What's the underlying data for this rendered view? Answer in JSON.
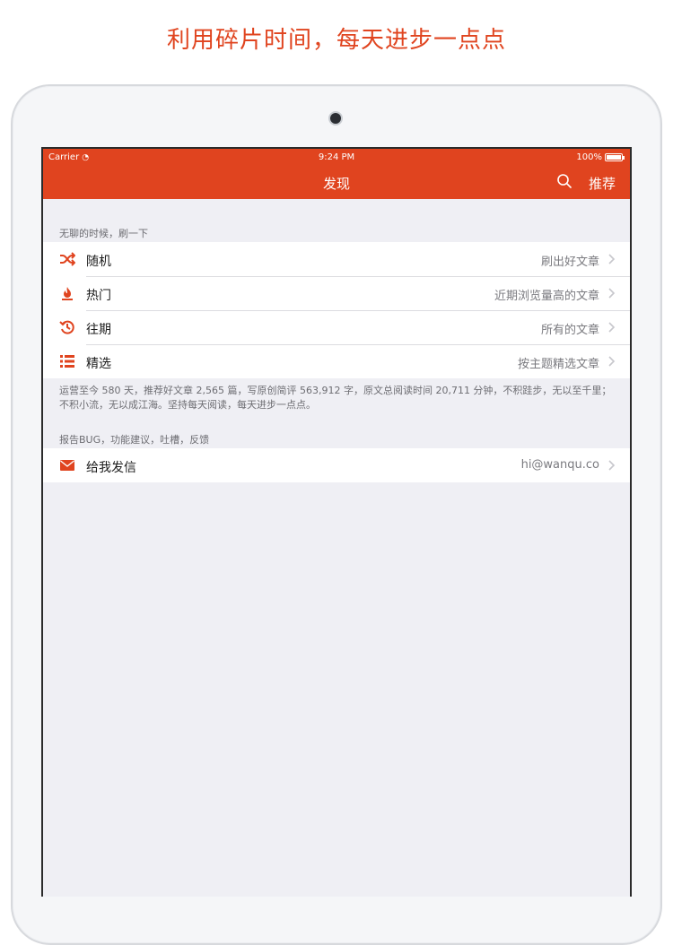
{
  "promo": {
    "title": "利用碎片时间，每天进步一点点"
  },
  "status_bar": {
    "carrier": "Carrier",
    "time": "9:24 PM",
    "battery": "100%"
  },
  "navbar": {
    "title": "发现",
    "right_label": "推荐",
    "search_icon": "search-icon"
  },
  "discover": {
    "header": "无聊的时候，刷一下",
    "items": [
      {
        "label": "随机",
        "detail": "刷出好文章",
        "icon": "shuffle-icon"
      },
      {
        "label": "热门",
        "detail": "近期浏览量高的文章",
        "icon": "flame-icon"
      },
      {
        "label": "往期",
        "detail": "所有的文章",
        "icon": "history-icon"
      },
      {
        "label": "精选",
        "detail": "按主题精选文章",
        "icon": "list-icon"
      }
    ],
    "footer": "运营至今 580 天，推荐好文章 2,565 篇，写原创简评 563,912 字，原文总阅读时间 20,711 分钟，不积跬步，无以至千里；不积小流，无以成江海。坚持每天阅读，每天进步一点点。"
  },
  "feedback": {
    "header": "报告BUG，功能建议，吐槽，反馈",
    "items": [
      {
        "label": "给我发信",
        "detail": "hi@wanqu.co",
        "icon": "mail-icon"
      }
    ]
  },
  "colors": {
    "accent": "#e0441f",
    "background": "#efeff4"
  }
}
